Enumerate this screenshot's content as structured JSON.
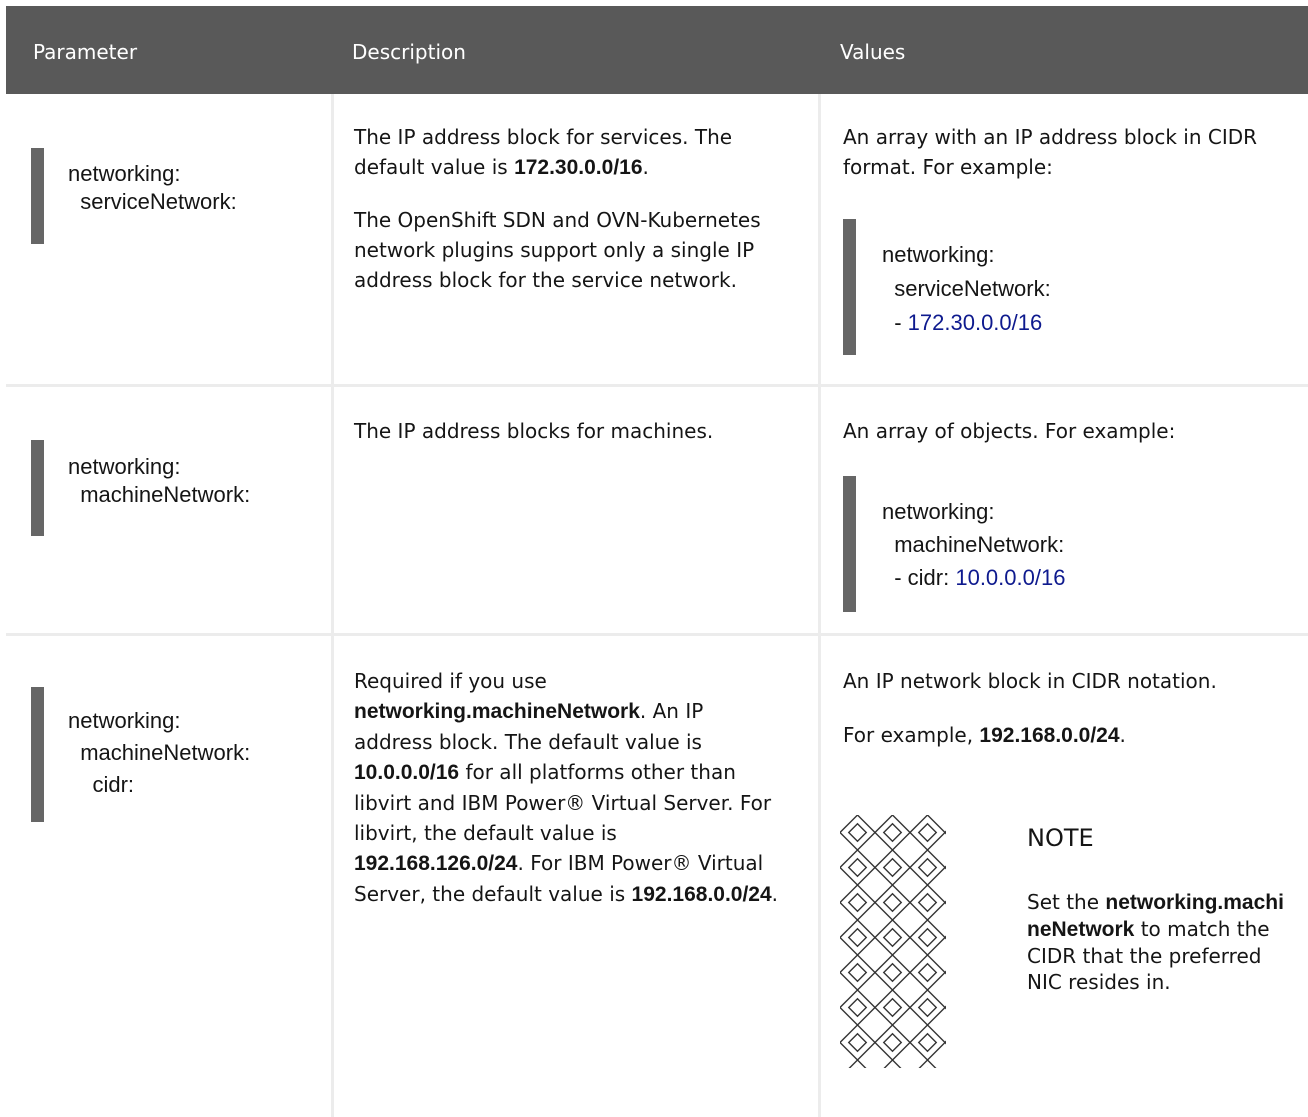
{
  "headers": {
    "parameter": "Parameter",
    "description": "Description",
    "values": "Values"
  },
  "rows": [
    {
      "param_lines": [
        "networking:",
        "  serviceNetwork:"
      ],
      "desc_p1_pre": "The IP address block for services. The default value is ",
      "desc_p1_bold": "172.30.0.0/16",
      "desc_p1_post": ".",
      "desc_p2": "The OpenShift SDN and OVN-Kubernetes network plugins support only a single IP address block for the service network.",
      "value_text": "An array with an IP address block in CIDR format. For example:",
      "example": {
        "line1": "networking:",
        "line2": "  serviceNetwork:",
        "line3_prefix": "  - ",
        "line3_value": "172.30.0.0/16"
      }
    },
    {
      "param_lines": [
        "networking:",
        "  machineNetwork:"
      ],
      "desc": "The IP address blocks for machines.",
      "value_text": "An array of objects. For example:",
      "example": {
        "line1": "networking:",
        "line2": "  machineNetwork:",
        "line3_prefix": "  - cidr: ",
        "line3_value": "10.0.0.0/16"
      }
    },
    {
      "param_lines": [
        "networking:",
        "  machineNetwork:",
        "    cidr:"
      ],
      "desc_seg1": "Required if you use ",
      "desc_bold1": "networking.machineNetwork",
      "desc_seg2": ". An IP address block. The default value is ",
      "desc_bold2": "10.0.0.0/16",
      "desc_seg3": " for all platforms other than libvirt and IBM Power® Virtual Server. For libvirt, the default value is ",
      "desc_bold3": "192.168.126.0/24",
      "desc_seg4": ". For IBM Power® Virtual Server, the default value is ",
      "desc_bold4": "192.168.0.0/24",
      "desc_seg5": ".",
      "value_text": "An IP network block in CIDR notation.",
      "value_example_pre": "For example, ",
      "value_example_bold": "192.168.0.0/24",
      "value_example_post": ".",
      "note": {
        "icon": "note-pattern-icon",
        "title": "NOTE",
        "body_pre": "Set the ",
        "body_bold": "networking.machineNetwork",
        "body_post": " to match the CIDR that the preferred NIC resides in."
      }
    }
  ],
  "colors": {
    "header_bg": "#595959",
    "code_bar": "#666666",
    "number": "#0e1a8e"
  }
}
